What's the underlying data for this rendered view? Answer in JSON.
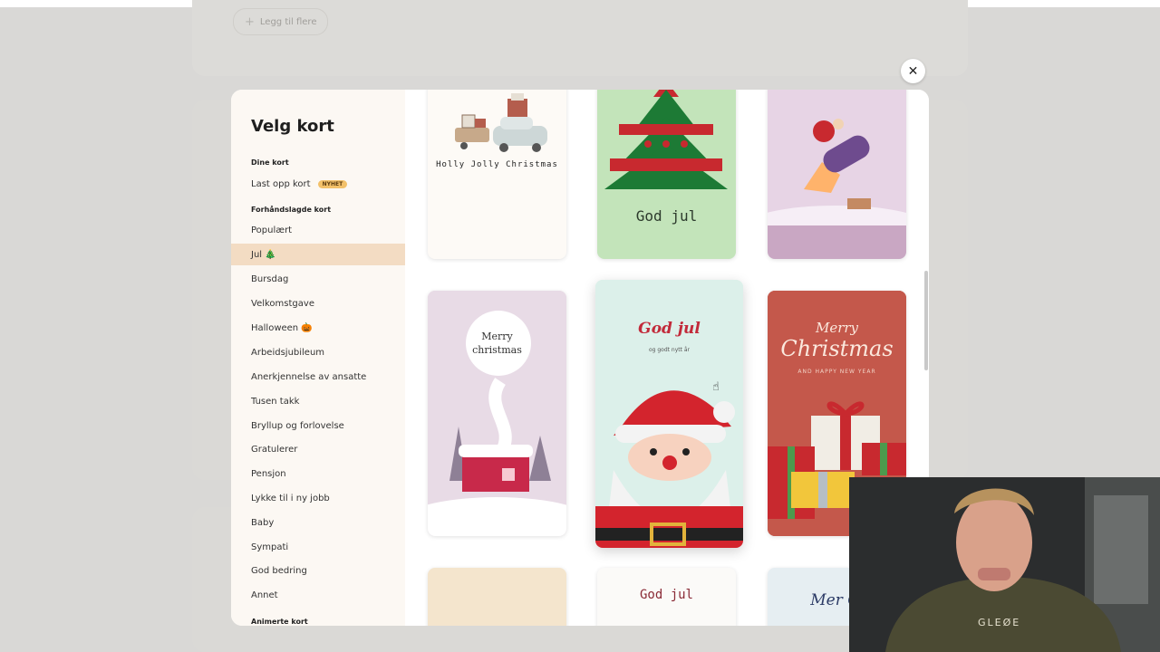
{
  "background": {
    "add_more_label": "Legg til flere"
  },
  "modal": {
    "title": "Velg kort",
    "sections": {
      "your_cards": "Dine kort",
      "premade": "Forhåndslagde kort",
      "animated": "Animerte kort"
    },
    "upload": {
      "label": "Last opp kort",
      "badge": "NYHET"
    },
    "categories": [
      "Populært",
      "Jul 🎄",
      "Bursdag",
      "Velkomstgave",
      "Halloween 🎃",
      "Arbeidsjubileum",
      "Anerkjennelse av ansatte",
      "Tusen takk",
      "Bryllup og forlovelse",
      "Gratulerer",
      "Pensjon",
      "Lykke til i ny jobb",
      "Baby",
      "Sympati",
      "God bedring",
      "Annet"
    ],
    "active_category": "Jul 🎄",
    "cards": {
      "card1_text": "Holly Jolly Christmas",
      "card2_text": "God jul",
      "card4_text_line1": "Merry",
      "card4_text_line2": "christmas",
      "card5_title": "God jul",
      "card5_subtitle": "og godt nytt år",
      "card6_line1": "Merry",
      "card6_line2": "Christmas",
      "card6_line3": "AND HAPPY NEW YEAR",
      "card8_text": "God jul",
      "card9_text": "Mer Chri"
    }
  },
  "webcam": {
    "sweater_text": "GLEØE"
  },
  "colors": {
    "active_bg": "#f3dcc3",
    "badge_bg": "#f3c16a",
    "sidebar_bg": "#fcf8f3"
  }
}
